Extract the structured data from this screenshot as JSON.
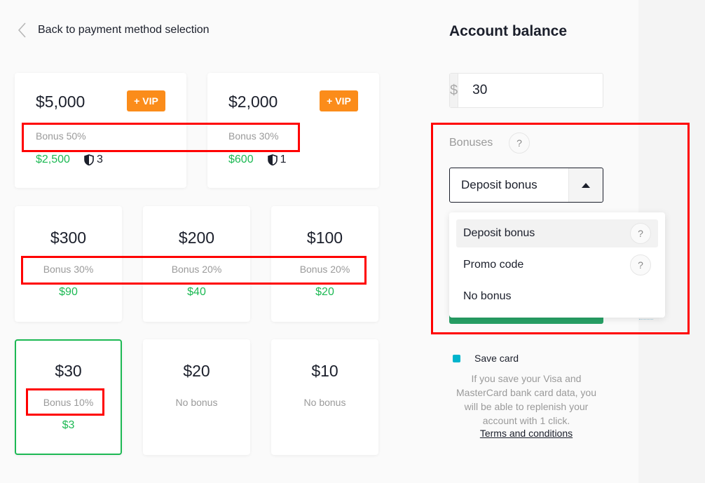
{
  "back_link": {
    "label": "Back to payment method selection",
    "icon": "chevron-left-icon"
  },
  "cards": [
    {
      "amount": "$5,000",
      "badge": "+ VIP",
      "bonus": "Bonus 50%",
      "bonus_value": "$2,500",
      "level_icon": "shield-icon",
      "level": "3",
      "selected": false
    },
    {
      "amount": "$2,000",
      "badge": "+ VIP",
      "bonus": "Bonus 30%",
      "bonus_value": "$600",
      "level_icon": "shield-icon",
      "level": "1",
      "selected": false
    },
    {
      "amount": "$300",
      "bonus": "Bonus 30%",
      "bonus_value": "$90",
      "selected": false
    },
    {
      "amount": "$200",
      "bonus": "Bonus 20%",
      "bonus_value": "$40",
      "selected": false
    },
    {
      "amount": "$100",
      "bonus": "Bonus 20%",
      "bonus_value": "$20",
      "selected": false
    },
    {
      "amount": "$30",
      "bonus": "Bonus 10%",
      "bonus_value": "$3",
      "selected": true
    },
    {
      "amount": "$20",
      "bonus": "No bonus",
      "bonus_value": "",
      "selected": false
    },
    {
      "amount": "$10",
      "bonus": "No bonus",
      "bonus_value": "",
      "selected": false
    }
  ],
  "account": {
    "title": "Account balance",
    "currency_symbol": "$",
    "amount_value": "30"
  },
  "bonuses": {
    "label": "Bonuses",
    "help": "?",
    "selected": "Deposit bonus",
    "options": [
      {
        "label": "Deposit bonus",
        "help": "?",
        "active": true
      },
      {
        "label": "Promo code",
        "help": "?",
        "active": false
      },
      {
        "label": "No bonus",
        "active": false
      }
    ]
  },
  "save_card": {
    "label": "Save card",
    "checked": true,
    "note": "If you save your Visa and MasterCard bank card data, you will be able to replenish your account with 1 click.",
    "terms_link": "Terms and conditions"
  },
  "colors": {
    "accent_green": "#1db954",
    "vip_orange": "#fb8c1a",
    "annotation_red": "#ff0000",
    "checkbox_teal": "#00b4cc"
  }
}
